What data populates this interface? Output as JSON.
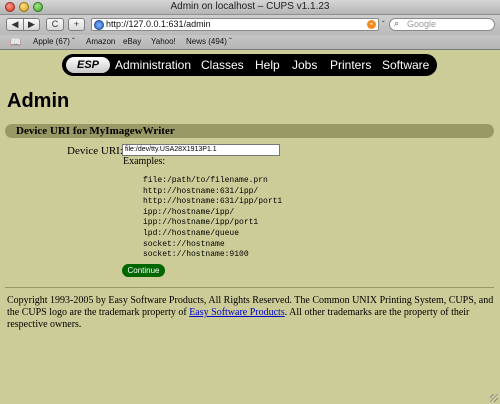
{
  "window": {
    "title": "Admin on localhost – CUPS v1.1.23"
  },
  "toolbar": {
    "back_icon": "◀",
    "forward_icon": "▶",
    "reload_icon": "C",
    "add_icon": "+",
    "url": "http://127.0.0.1:631/admin",
    "url_dropdown_icon": "ˇ",
    "search_placeholder": "Google",
    "search_icon": "magnifier-icon"
  },
  "bookmarks": {
    "items": [
      {
        "label": "Apple (67) ˇ"
      },
      {
        "label": "Amazon"
      },
      {
        "label": "eBay"
      },
      {
        "label": "Yahoo!"
      },
      {
        "label": "News (494) ˇ"
      }
    ]
  },
  "nav": {
    "logo": "ESP",
    "links": [
      {
        "label": "Administration"
      },
      {
        "label": "Classes"
      },
      {
        "label": "Help"
      },
      {
        "label": "Jobs"
      },
      {
        "label": "Printers"
      },
      {
        "label": "Software"
      }
    ]
  },
  "main": {
    "title": "Admin",
    "section_title": "Device URI for MyImagewWriter",
    "device_uri_label": "Device URI:",
    "device_uri_value": "file:/dev/tty.USA28X1913P1.1",
    "examples_label": "Examples:",
    "examples": "file:/path/to/filename.prn\nhttp://hostname:631/ipp/\nhttp://hostname:631/ipp/port1\nipp://hostname/ipp/\nipp://hostname/ipp/port1\nlpd://hostname/queue\nsocket://hostname\nsocket://hostname:9100",
    "continue_label": "Continue"
  },
  "footer": {
    "text_before": "Copyright 1993-2005 by Easy Software Products, All Rights Reserved. The Common UNIX Printing System, CUPS, and the CUPS logo are the trademark property of ",
    "link_text": "Easy Software Products",
    "text_after": ". All other trademarks are the property of their respective owners."
  },
  "colors": {
    "page_background": "#cccc99",
    "section_bar": "#999966",
    "continue_button": "#006600",
    "link": "#0000cc"
  }
}
